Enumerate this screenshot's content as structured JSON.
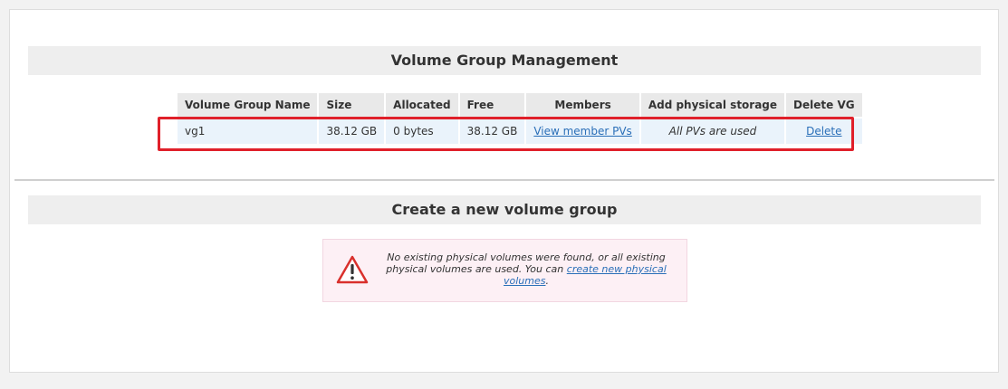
{
  "sections": {
    "vg_management_title": "Volume Group Management",
    "create_title": "Create a new volume group"
  },
  "table": {
    "headers": [
      "Volume Group Name",
      "Size",
      "Allocated",
      "Free",
      "Members",
      "Add physical storage",
      "Delete VG"
    ],
    "rows": [
      {
        "name": "vg1",
        "size": "38.12 GB",
        "allocated": "0 bytes",
        "free": "38.12 GB",
        "members_link": "View member PVs",
        "add_storage": "All PVs are used",
        "delete_link": "Delete"
      }
    ]
  },
  "warning": {
    "icon": "warning-triangle-icon",
    "text_before": "No existing physical volumes were found, or all existing physical volumes are used. You can ",
    "link": "create new physical volumes",
    "text_after": "."
  },
  "colors": {
    "link": "#2a6fb8",
    "highlight": "#e0202a",
    "row_bg": "#eaf3fb",
    "warning_bg": "#fdf0f5",
    "warning_icon": "#d9302c"
  }
}
